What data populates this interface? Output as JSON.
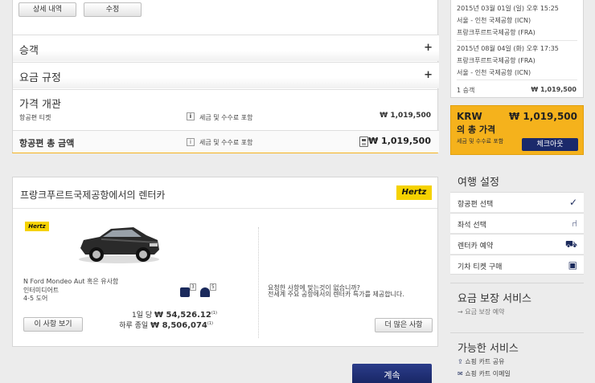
{
  "top_buttons": {
    "details": "상세 내역",
    "modify": "수정"
  },
  "accordion": {
    "passengers": "승객",
    "fare_rules": "요금 규정",
    "expand_symbol": "+"
  },
  "price_overview": {
    "title": "가격 개관",
    "flight_ticket_label": "항공편 티켓",
    "taxes_label": "세금 및 수수료 포함",
    "flight_ticket_price": "₩ 1,019,500",
    "total_label": "항공편 총 금액",
    "total_taxes_label": "세금 및 수수료 포함",
    "total_price": "₩ 1,019,500",
    "info_symbol": "i"
  },
  "itinerary": {
    "outbound": {
      "datetime": "2015년 03월 01일 (일) 오후 15:25",
      "from": "서울 - 인천 국제공항 (ICN)",
      "to": "프랑크푸르트국제공항 (FRA)"
    },
    "inbound": {
      "datetime": "2015년 08월 04일 (화) 오후 17:35",
      "from": "프랑크푸르트국제공항 (FRA)",
      "to": "서울 - 인천 국제공항 (ICN)"
    },
    "passengers": "1 승객",
    "price": "₩ 1,019,500"
  },
  "total_box": {
    "currency": "KRW",
    "amount": "₩ 1,019,500",
    "label": "의 총 가격",
    "taxes": "세금 및 수수료 포함",
    "checkout": "체크아웃",
    "accent_color": "#f5b21c",
    "button_color": "#1b2a6b"
  },
  "rental": {
    "title": "프랑크푸르트국제공항에서의 렌터카",
    "brand": "Hertz",
    "car_name": "N Ford Mondeo Aut 혹은 유사함",
    "car_class": "인터미디어트",
    "doors": "4-5 도어",
    "luggage_count": "3",
    "seat_count": "5",
    "per_day_label": "1일 당",
    "per_day_price": "₩ 54,526.12",
    "total_label": "하루 종일",
    "total_price": "₩ 8,506,074",
    "footnote": "(1)",
    "view_button": "이 사항 보기",
    "not_found_text": "요청한 사항에 맞는것이 없습니까?",
    "offer_text": "전세계 주요 공항에서의 렌터카 특가를 제공합니다.",
    "more_button": "더 많은 사항"
  },
  "continue_button": "계속",
  "travel_settings": {
    "title": "여행 설정",
    "items": [
      {
        "label": "항공편 선택",
        "icon": "checkmark-icon"
      },
      {
        "label": "좌석 선택",
        "icon": "seat-icon"
      },
      {
        "label": "렌터카 예약",
        "icon": "car-icon"
      },
      {
        "label": "기차 티켓 구매",
        "icon": "train-icon"
      }
    ]
  },
  "fare_guarantee": {
    "title": "요금 보장 서비스",
    "link": "요금 보장 예약"
  },
  "services": {
    "title": "가능한 서비스",
    "items": [
      "쇼핑 카트 공유",
      "쇼핑 카트 이메일"
    ]
  }
}
